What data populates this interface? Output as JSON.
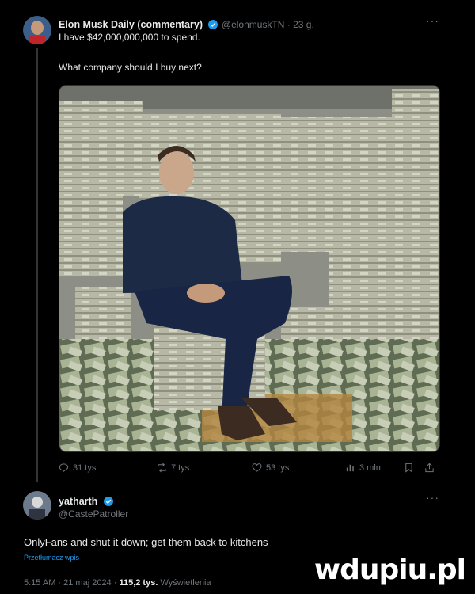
{
  "tweet": {
    "author_name": "Elon Musk Daily (commentary)",
    "handle_time": "@elonmuskTN · 23 g.",
    "line1": "I have $42,000,000,000 to spend.",
    "line2": "What company should I buy next?",
    "stats": {
      "replies": "31 tys.",
      "reposts": "7 tys.",
      "likes": "53 tys.",
      "views": "3 mln"
    }
  },
  "reply": {
    "author_name": "yatharth",
    "handle": "@CastePatroller",
    "text": "OnlyFans and shut it down; get them back to kitchens",
    "translate": "Przetłumacz wpis",
    "timestamp": "5:15 AM · 21 maj 2024 · ",
    "views_count": "115,2 tys.",
    "views_label": " Wyświetlenia"
  },
  "watermark": "wdupiu.pl",
  "colors": {
    "background": "#000000",
    "verified": "#1d9bf0",
    "muted": "#71767b"
  },
  "icons": [
    "verified-icon",
    "more-icon",
    "reply-icon",
    "repost-icon",
    "like-icon",
    "views-icon",
    "bookmark-icon",
    "share-icon"
  ]
}
